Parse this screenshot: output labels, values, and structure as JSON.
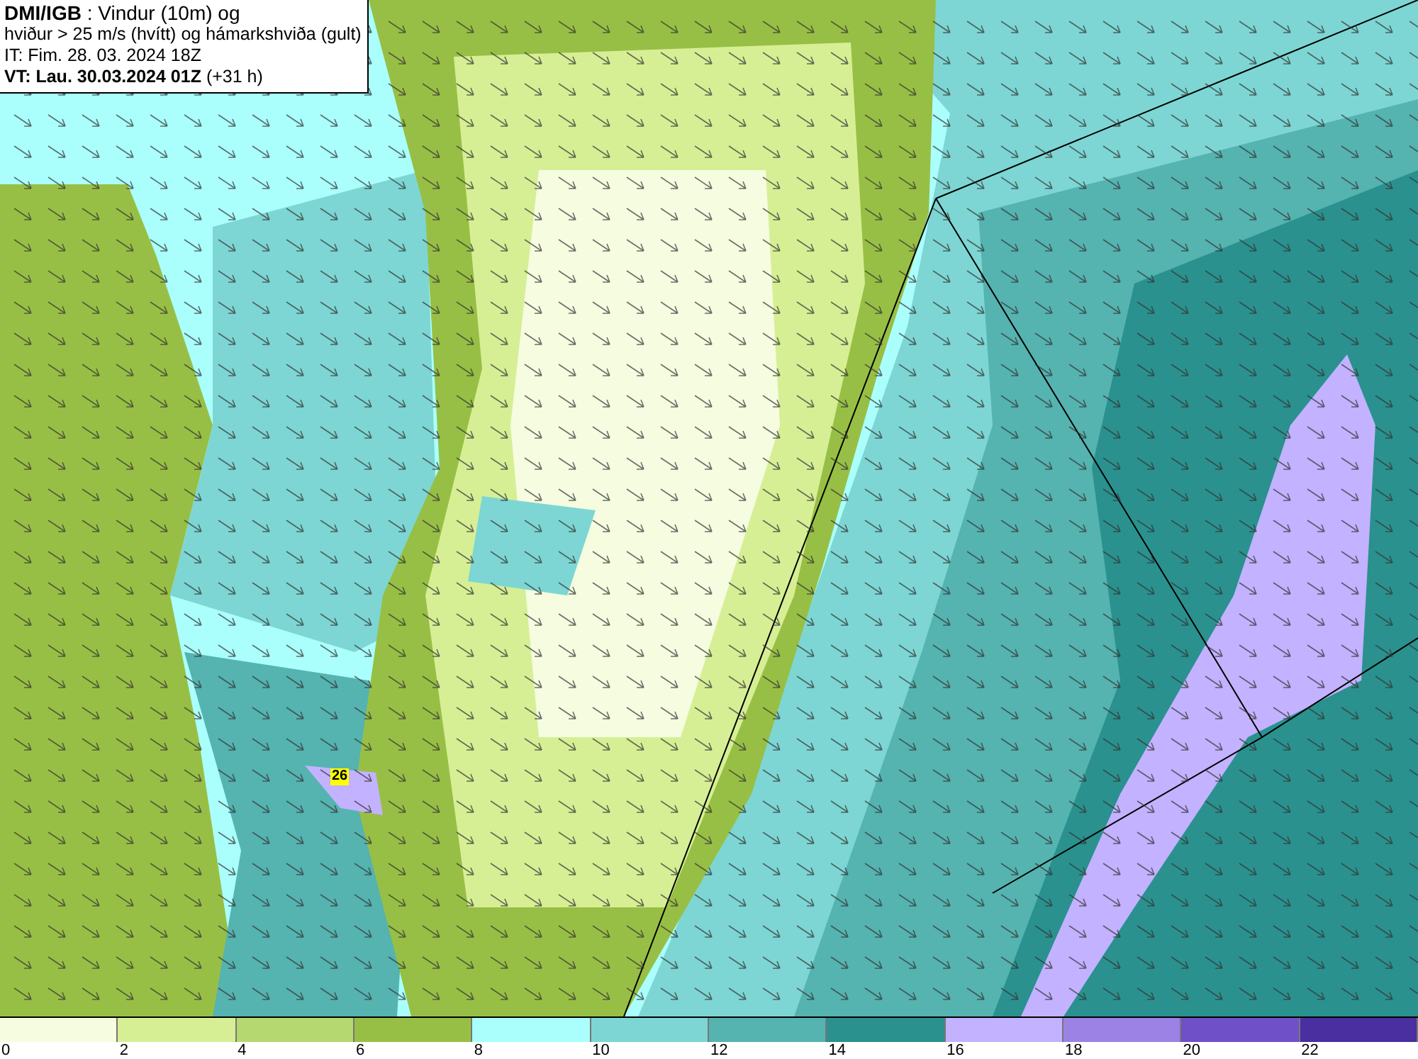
{
  "header": {
    "lines": [
      "**DMI/IGB** : Vindur (10m) og",
      "hviður > 25 m/s (hvítt) og hámarkshviða (gult)",
      "IT: Fim. 28. 03. 2024 18Z",
      "**VT: Lau. 30.03.2024 01Z** (+31 h)"
    ]
  },
  "gust_label": {
    "value": "26"
  },
  "legend": {
    "segments": [
      {
        "label": "0",
        "color": "#f5fce0"
      },
      {
        "label": "2",
        "color": "#d6ef95"
      },
      {
        "label": "4",
        "color": "#b5d870"
      },
      {
        "label": "6",
        "color": "#98bf45"
      },
      {
        "label": "8",
        "color": "#aafffc"
      },
      {
        "label": "10",
        "color": "#7dd6d3"
      },
      {
        "label": "12",
        "color": "#55b3b0"
      },
      {
        "label": "14",
        "color": "#2a918e"
      },
      {
        "label": "16",
        "color": "#c2b2ff"
      },
      {
        "label": "18",
        "color": "#9b82e4"
      },
      {
        "label": "20",
        "color": "#6f50c8"
      },
      {
        "label": "22",
        "color": "#4a2fa0"
      }
    ]
  }
}
